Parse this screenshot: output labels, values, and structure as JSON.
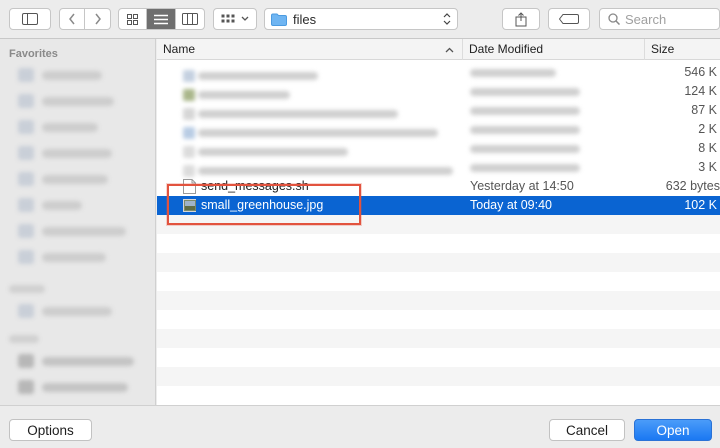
{
  "toolbar": {
    "path_label": "files",
    "search_placeholder": "Search",
    "icons": [
      "sidebar-toggle-icon",
      "back-icon",
      "forward-icon",
      "icon-view-icon",
      "list-view-icon",
      "column-view-icon",
      "gallery-view-icon",
      "folder-icon",
      "share-icon",
      "tag-icon",
      "search-icon"
    ]
  },
  "sidebar": {
    "sections": [
      {
        "label": "Favorites",
        "items": 8
      },
      {
        "label": "Devices",
        "items": 1
      },
      {
        "label": "Shared",
        "items": 2
      }
    ]
  },
  "columns": {
    "name": "Name",
    "date": "Date Modified",
    "size": "Size"
  },
  "files": [
    {
      "name": "",
      "date": "",
      "size": "546 K",
      "blurred": true
    },
    {
      "name": "",
      "date": "",
      "size": "124 K",
      "blurred": true
    },
    {
      "name": "",
      "date": "",
      "size": "87 K",
      "blurred": true
    },
    {
      "name": "",
      "date": "",
      "size": "2 K",
      "blurred": true
    },
    {
      "name": "",
      "date": "",
      "size": "8 K",
      "blurred": true
    },
    {
      "name": "",
      "date": "",
      "size": "3 K",
      "blurred": true
    },
    {
      "name": "send_messages.sh",
      "date": "Yesterday at 14:50",
      "size": "632 bytes",
      "blurred": false
    },
    {
      "name": "small_greenhouse.jpg",
      "date": "Today at 09:40",
      "size": "102 K",
      "blurred": false,
      "selected": true
    }
  ],
  "footer": {
    "options_label": "Options",
    "cancel_label": "Cancel",
    "open_label": "Open"
  },
  "colors": {
    "selection": "#0a64d2",
    "highlight": "#e2533e",
    "primary_button": "#1a78f2"
  }
}
